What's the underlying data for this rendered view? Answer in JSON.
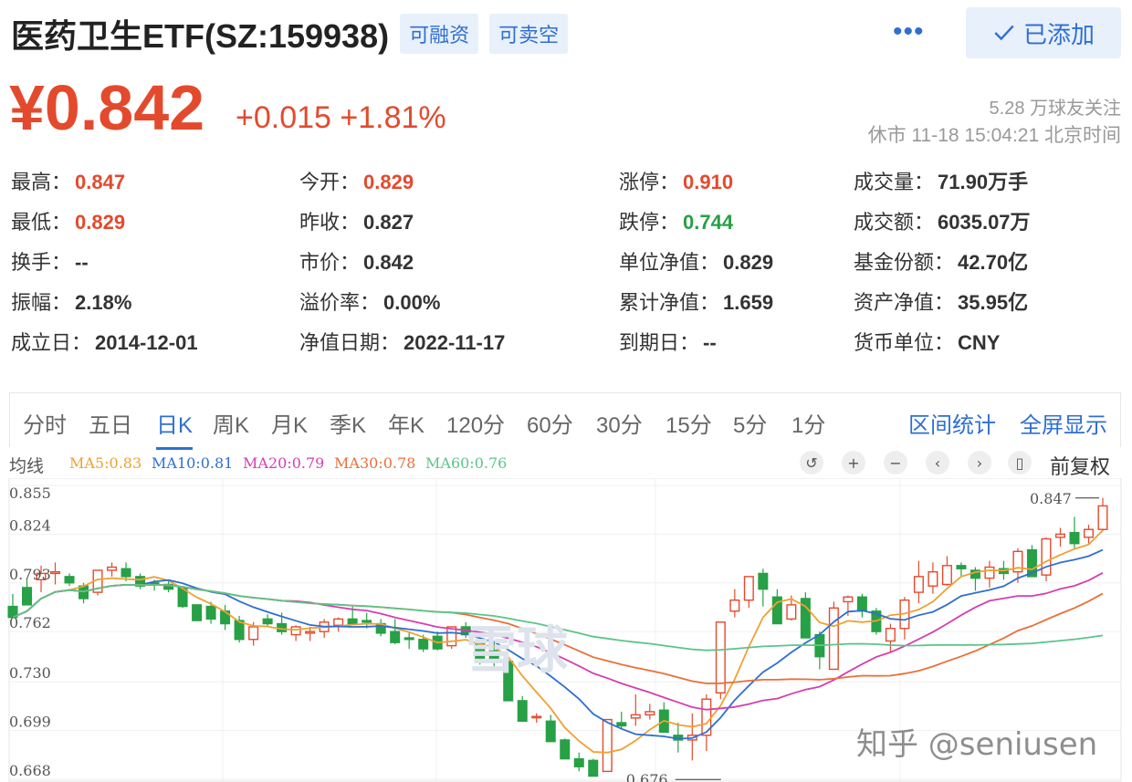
{
  "header": {
    "title": "医药卫生ETF(SZ:159938)",
    "tag1": "可融资",
    "tag2": "可卖空",
    "more": "•••",
    "added_label": "已添加"
  },
  "quote": {
    "price": "¥0.842",
    "change": "+0.015  +1.81%",
    "followers": "5.28 万球友关注",
    "timestamp": "休市 11-18 15:04:21 北京时间"
  },
  "stats": [
    {
      "label": "最高：",
      "value": "0.847",
      "tone": "red"
    },
    {
      "label": "今开：",
      "value": "0.829",
      "tone": "red"
    },
    {
      "label": "涨停：",
      "value": "0.910",
      "tone": "red"
    },
    {
      "label": "成交量：",
      "value": "71.90万手",
      "tone": ""
    },
    {
      "label": "最低：",
      "value": "0.829",
      "tone": "red"
    },
    {
      "label": "昨收：",
      "value": "0.827",
      "tone": ""
    },
    {
      "label": "跌停：",
      "value": "0.744",
      "tone": "green"
    },
    {
      "label": "成交额：",
      "value": "6035.07万",
      "tone": ""
    },
    {
      "label": "换手：",
      "value": "--",
      "tone": ""
    },
    {
      "label": "市价：",
      "value": "0.842",
      "tone": ""
    },
    {
      "label": "单位净值：",
      "value": "0.829",
      "tone": ""
    },
    {
      "label": "基金份额：",
      "value": "42.70亿",
      "tone": ""
    },
    {
      "label": "振幅：",
      "value": "2.18%",
      "tone": ""
    },
    {
      "label": "溢价率：",
      "value": "0.00%",
      "tone": ""
    },
    {
      "label": "累计净值：",
      "value": "1.659",
      "tone": ""
    },
    {
      "label": "资产净值：",
      "value": "35.95亿",
      "tone": ""
    },
    {
      "label": "成立日：",
      "value": "2014-12-01",
      "tone": ""
    },
    {
      "label": "净值日期：",
      "value": "2022-11-17",
      "tone": ""
    },
    {
      "label": "到期日：",
      "value": "--",
      "tone": ""
    },
    {
      "label": "货币单位：",
      "value": "CNY",
      "tone": ""
    }
  ],
  "tabs": [
    "分时",
    "五日",
    "日K",
    "周K",
    "月K",
    "季K",
    "年K",
    "120分",
    "60分",
    "30分",
    "15分",
    "5分",
    "1分"
  ],
  "active_tab": "日K",
  "tab_links": [
    "区间统计",
    "全屏显示"
  ],
  "ma": {
    "title": "均线",
    "items": [
      {
        "label": "MA5:0.83",
        "color": "#f0a030"
      },
      {
        "label": "MA10:0.81",
        "color": "#2f6fd0"
      },
      {
        "label": "MA20:0.79",
        "color": "#d43fb0"
      },
      {
        "label": "MA30:0.78",
        "color": "#e8703a"
      },
      {
        "label": "MA60:0.76",
        "color": "#5cc48a"
      }
    ],
    "controls": [
      "undo-icon",
      "zoom-in-icon",
      "zoom-out-icon",
      "prev-icon",
      "next-icon",
      "candle-icon"
    ],
    "adjust_label": "前复权"
  },
  "watermark": "知乎 @seniusen",
  "chart_logo": "雪球",
  "chart_data": {
    "type": "candlestick",
    "y_ticks": [
      "0.855",
      "0.824",
      "0.793",
      "0.762",
      "0.730",
      "0.699",
      "0.668"
    ],
    "ylim": [
      0.668,
      0.855
    ],
    "high_label": "0.847",
    "low_label": "0.676",
    "colors": {
      "up": "#e34a2d",
      "down": "#27a046"
    },
    "candles": [
      [
        0.778,
        0.786,
        0.771,
        0.771
      ],
      [
        0.79,
        0.796,
        0.779,
        0.779
      ],
      [
        0.795,
        0.804,
        0.787,
        0.799
      ],
      [
        0.799,
        0.806,
        0.792,
        0.8
      ],
      [
        0.797,
        0.799,
        0.791,
        0.793
      ],
      [
        0.791,
        0.793,
        0.78,
        0.783
      ],
      [
        0.787,
        0.801,
        0.785,
        0.801
      ],
      [
        0.801,
        0.806,
        0.797,
        0.803
      ],
      [
        0.802,
        0.806,
        0.794,
        0.797
      ],
      [
        0.797,
        0.799,
        0.789,
        0.791
      ],
      [
        0.793,
        0.795,
        0.788,
        0.792
      ],
      [
        0.792,
        0.795,
        0.787,
        0.789
      ],
      [
        0.79,
        0.791,
        0.777,
        0.778
      ],
      [
        0.779,
        0.779,
        0.769,
        0.769
      ],
      [
        0.778,
        0.781,
        0.767,
        0.77
      ],
      [
        0.775,
        0.779,
        0.763,
        0.767
      ],
      [
        0.769,
        0.772,
        0.755,
        0.757
      ],
      [
        0.757,
        0.768,
        0.753,
        0.765
      ],
      [
        0.77,
        0.773,
        0.765,
        0.767
      ],
      [
        0.767,
        0.774,
        0.76,
        0.762
      ],
      [
        0.76,
        0.766,
        0.756,
        0.765
      ],
      [
        0.761,
        0.765,
        0.756,
        0.762
      ],
      [
        0.762,
        0.77,
        0.758,
        0.768
      ],
      [
        0.766,
        0.771,
        0.762,
        0.77
      ],
      [
        0.77,
        0.778,
        0.766,
        0.767
      ],
      [
        0.769,
        0.774,
        0.764,
        0.768
      ],
      [
        0.767,
        0.77,
        0.759,
        0.761
      ],
      [
        0.762,
        0.77,
        0.754,
        0.755
      ],
      [
        0.758,
        0.762,
        0.751,
        0.757
      ],
      [
        0.757,
        0.76,
        0.749,
        0.751
      ],
      [
        0.759,
        0.762,
        0.75,
        0.751
      ],
      [
        0.753,
        0.765,
        0.751,
        0.765
      ],
      [
        0.765,
        0.768,
        0.758,
        0.76
      ],
      [
        0.755,
        0.757,
        0.741,
        0.743
      ],
      [
        0.75,
        0.755,
        0.739,
        0.743
      ],
      [
        0.743,
        0.744,
        0.718,
        0.718
      ],
      [
        0.718,
        0.721,
        0.705,
        0.705
      ],
      [
        0.708,
        0.71,
        0.704,
        0.708
      ],
      [
        0.705,
        0.709,
        0.692,
        0.692
      ],
      [
        0.693,
        0.694,
        0.681,
        0.681
      ],
      [
        0.681,
        0.685,
        0.673,
        0.676
      ],
      [
        0.68,
        0.681,
        0.67,
        0.67
      ],
      [
        0.673,
        0.706,
        0.673,
        0.706
      ],
      [
        0.704,
        0.711,
        0.7,
        0.702
      ],
      [
        0.707,
        0.722,
        0.702,
        0.709
      ],
      [
        0.709,
        0.716,
        0.706,
        0.711
      ],
      [
        0.712,
        0.717,
        0.698,
        0.698
      ],
      [
        0.696,
        0.704,
        0.685,
        0.693
      ],
      [
        0.693,
        0.71,
        0.68,
        0.696
      ],
      [
        0.696,
        0.722,
        0.686,
        0.719
      ],
      [
        0.723,
        0.728,
        0.719,
        0.768
      ],
      [
        0.775,
        0.789,
        0.771,
        0.782
      ],
      [
        0.782,
        0.797,
        0.777,
        0.797
      ],
      [
        0.799,
        0.802,
        0.778,
        0.789
      ],
      [
        0.784,
        0.789,
        0.767,
        0.767
      ],
      [
        0.77,
        0.785,
        0.769,
        0.779
      ],
      [
        0.783,
        0.787,
        0.758,
        0.758
      ],
      [
        0.76,
        0.762,
        0.738,
        0.746
      ],
      [
        0.738,
        0.781,
        0.738,
        0.777
      ],
      [
        0.781,
        0.785,
        0.772,
        0.784
      ],
      [
        0.784,
        0.786,
        0.771,
        0.775
      ],
      [
        0.775,
        0.777,
        0.76,
        0.762
      ],
      [
        0.756,
        0.767,
        0.749,
        0.764
      ],
      [
        0.764,
        0.784,
        0.757,
        0.782
      ],
      [
        0.787,
        0.807,
        0.78,
        0.797
      ],
      [
        0.791,
        0.806,
        0.786,
        0.8
      ],
      [
        0.792,
        0.81,
        0.791,
        0.804
      ],
      [
        0.804,
        0.806,
        0.797,
        0.802
      ],
      [
        0.801,
        0.803,
        0.788,
        0.796
      ],
      [
        0.796,
        0.807,
        0.79,
        0.803
      ],
      [
        0.802,
        0.807,
        0.795,
        0.799
      ],
      [
        0.8,
        0.815,
        0.793,
        0.813
      ],
      [
        0.814,
        0.817,
        0.797,
        0.797
      ],
      [
        0.798,
        0.822,
        0.794,
        0.821
      ],
      [
        0.822,
        0.828,
        0.816,
        0.824
      ],
      [
        0.825,
        0.835,
        0.815,
        0.818
      ],
      [
        0.822,
        0.83,
        0.818,
        0.827
      ],
      [
        0.827,
        0.847,
        0.826,
        0.842
      ]
    ]
  }
}
